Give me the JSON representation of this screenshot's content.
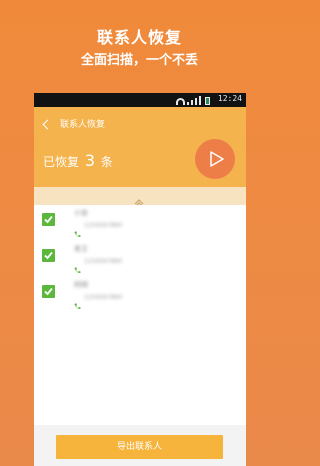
{
  "promo": {
    "title": "联系人恢复",
    "subtitle": "全面扫描，一个不丢"
  },
  "status_bar": {
    "time": "12:24",
    "icons": [
      "wifi-icon",
      "signal-icon",
      "battery-icon"
    ]
  },
  "header": {
    "back_icon": "chevron-left-icon",
    "title": "联系人恢复",
    "recovered_prefix": "已恢复",
    "recovered_count": "3",
    "recovered_suffix": "条",
    "play_icon": "play-icon"
  },
  "contacts": [
    {
      "name": "小张",
      "number": "1234567890",
      "checked": true
    },
    {
      "name": "老王",
      "number": "1234567890",
      "checked": true
    },
    {
      "name": "阿明",
      "number": "1234567890",
      "checked": true
    }
  ],
  "footer": {
    "export_label": "导出联系人"
  },
  "colors": {
    "background": "#f08a3a",
    "header": "#f4b34c",
    "play_button": "#ed7e48",
    "collapse_bar": "#f8e3c1",
    "checkbox": "#5cb83c",
    "export_button": "#f6b43d"
  }
}
